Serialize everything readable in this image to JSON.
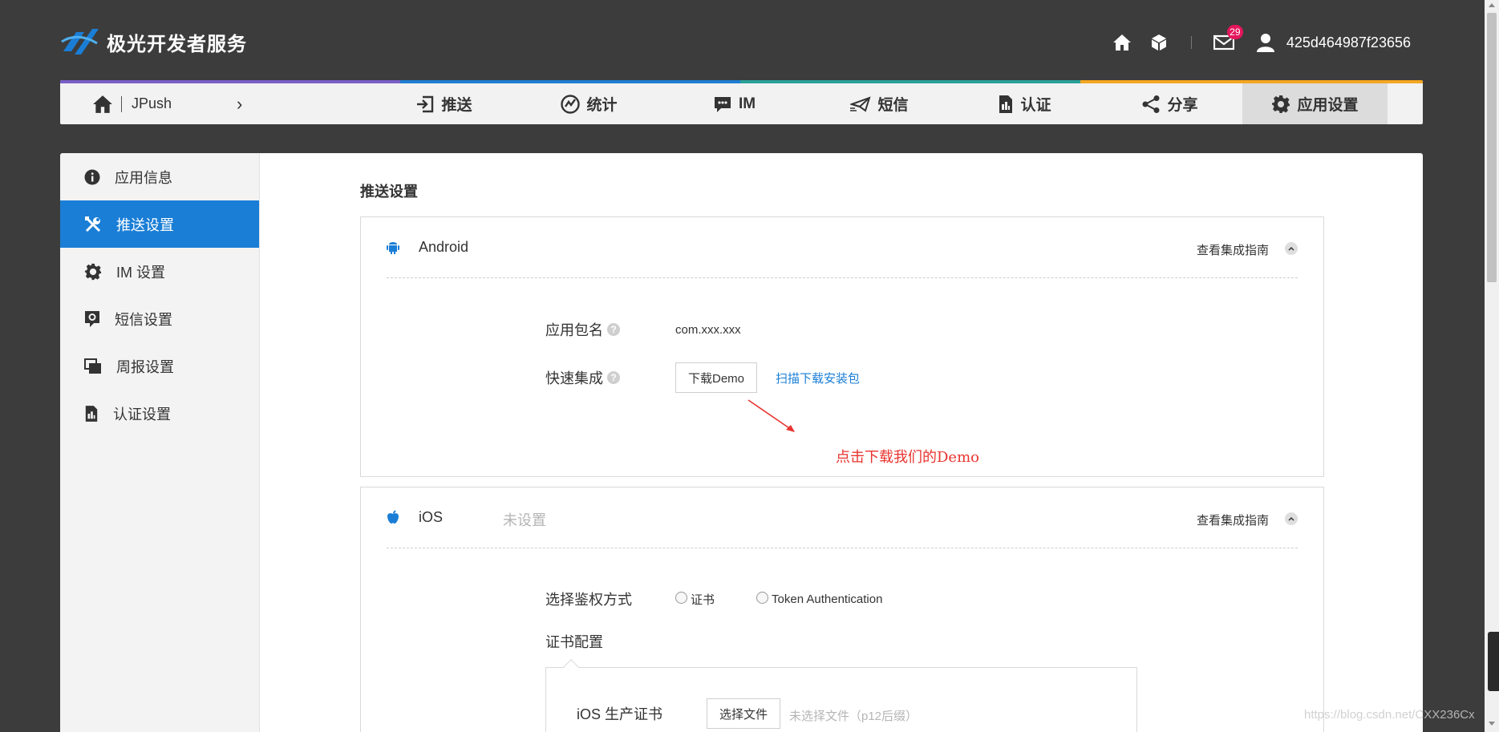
{
  "header": {
    "logo_text": "极光开发者服务",
    "mail_badge": "29",
    "username": "425d464987f23656"
  },
  "product_nav": {
    "home_label": "JPush",
    "chevron": "›",
    "stripe_colors": [
      "#7b5fc9",
      "#1f7ed1",
      "#2aa198",
      "#f5a623"
    ],
    "tabs": [
      {
        "label": "推送",
        "icon": "push-arrow-icon"
      },
      {
        "label": "统计",
        "icon": "stats-icon"
      },
      {
        "label": "IM",
        "icon": "chat-icon"
      },
      {
        "label": "短信",
        "icon": "sms-icon"
      },
      {
        "label": "认证",
        "icon": "auth-icon"
      },
      {
        "label": "分享",
        "icon": "share-icon"
      },
      {
        "label": "应用设置",
        "icon": "gear-icon",
        "active": true
      }
    ]
  },
  "sidebar": {
    "active_color": "#1a7ed6",
    "items": [
      {
        "label": "应用信息",
        "icon": "info-icon"
      },
      {
        "label": "推送设置",
        "icon": "tools-icon",
        "active": true
      },
      {
        "label": "IM 设置",
        "icon": "gear-icon"
      },
      {
        "label": "短信设置",
        "icon": "sms-settings-icon"
      },
      {
        "label": "周报设置",
        "icon": "report-icon"
      },
      {
        "label": "认证设置",
        "icon": "auth-icon"
      }
    ]
  },
  "main": {
    "section_title": "推送设置",
    "android": {
      "name": "Android",
      "guide": "查看集成指南",
      "pkg_label": "应用包名",
      "pkg_value": "com.xxx.xxx",
      "quick_label": "快速集成",
      "download_btn": "下载Demo",
      "scan_link": "扫描下载安装包",
      "annotation": "点击下载我们的Demo"
    },
    "ios": {
      "name": "iOS",
      "status": "未设置",
      "guide": "查看集成指南",
      "auth_label": "选择鉴权方式",
      "radio_cert": "证书",
      "radio_token": "Token Authentication",
      "cert_config_label": "证书配置",
      "prod_cert_label": "iOS 生产证书",
      "choose_file_btn": "选择文件",
      "no_file_hint": "未选择文件（p12后缀）"
    }
  },
  "watermark": "https://blog.csdn.net/CXX236Cx"
}
